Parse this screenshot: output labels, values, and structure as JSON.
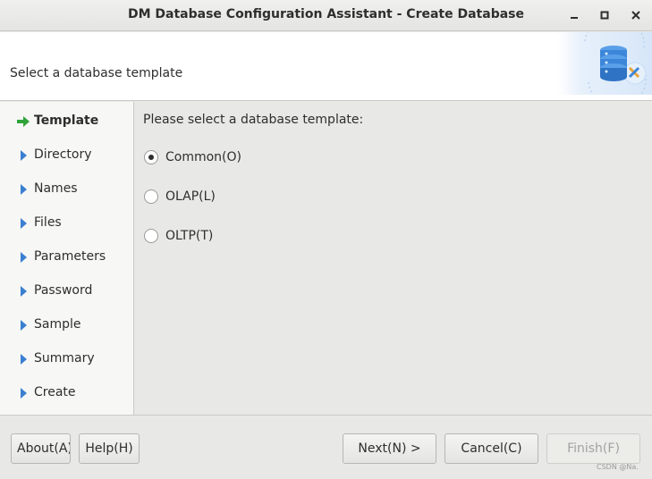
{
  "window": {
    "title": "DM Database Configuration Assistant - Create Database",
    "minimize_icon": "minimize-icon",
    "maximize_icon": "maximize-icon",
    "close_icon": "close-icon"
  },
  "header": {
    "title": "Select a database template",
    "banner_icon": "database-settings-icon"
  },
  "sidebar": {
    "steps": [
      {
        "label": "Template",
        "icon": "arrow-right-icon",
        "active": true
      },
      {
        "label": "Directory",
        "icon": "triangle-right-icon",
        "active": false
      },
      {
        "label": "Names",
        "icon": "triangle-right-icon",
        "active": false
      },
      {
        "label": "Files",
        "icon": "triangle-right-icon",
        "active": false
      },
      {
        "label": "Parameters",
        "icon": "triangle-right-icon",
        "active": false
      },
      {
        "label": "Password",
        "icon": "triangle-right-icon",
        "active": false
      },
      {
        "label": "Sample",
        "icon": "triangle-right-icon",
        "active": false
      },
      {
        "label": "Summary",
        "icon": "triangle-right-icon",
        "active": false
      },
      {
        "label": "Create",
        "icon": "triangle-right-icon",
        "active": false
      }
    ]
  },
  "main": {
    "prompt": "Please select a database template:",
    "options": [
      {
        "label": "Common(O)",
        "selected": true
      },
      {
        "label": "OLAP(L)",
        "selected": false
      },
      {
        "label": "OLTP(T)",
        "selected": false
      }
    ]
  },
  "footer": {
    "about_label": "About(A)",
    "help_label": "Help(H)",
    "next_label": "Next(N) >",
    "cancel_label": "Cancel(C)",
    "finish_label": "Finish(F)",
    "finish_enabled": false,
    "watermark": "CSDN @Na."
  },
  "colors": {
    "active_step_arrow": "#2fa33a",
    "step_triangle": "#3a7fd0",
    "banner_blue": "#3b86d9"
  }
}
